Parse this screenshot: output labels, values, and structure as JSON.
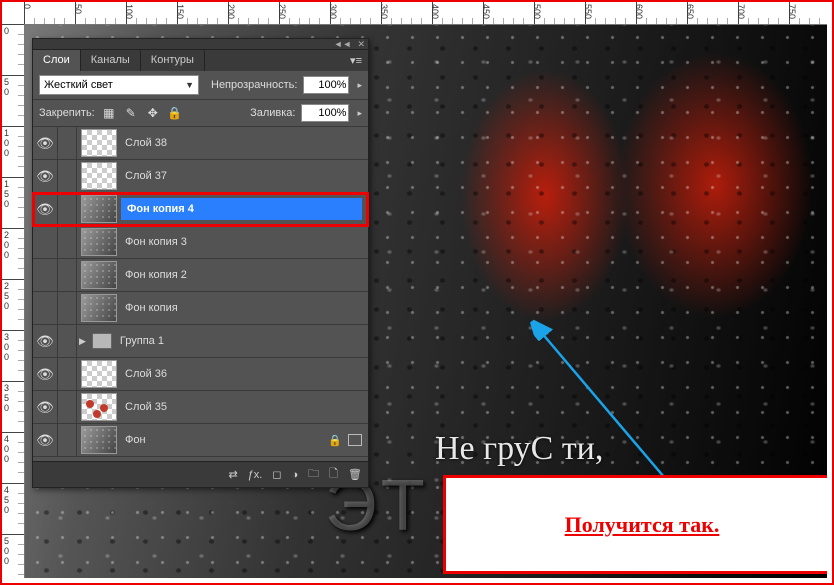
{
  "tabs": {
    "layers": "Слои",
    "channels": "Каналы",
    "paths": "Контуры"
  },
  "blend": {
    "mode": "Жесткий свет",
    "opacity_label": "Непрозрачность:",
    "opacity": "100%",
    "fill_label": "Заливка:",
    "fill": "100%",
    "lock_label": "Закрепить:"
  },
  "layers": [
    {
      "name": "Слой 38",
      "visible": true,
      "thumb": "transparent"
    },
    {
      "name": "Слой 37",
      "visible": true,
      "thumb": "transparent"
    },
    {
      "name": "Фон копия 4",
      "visible": true,
      "thumb": "image",
      "selected": true
    },
    {
      "name": "Фон копия 3",
      "visible": false,
      "thumb": "image"
    },
    {
      "name": "Фон копия 2",
      "visible": false,
      "thumb": "image"
    },
    {
      "name": "Фон копия",
      "visible": false,
      "thumb": "image"
    },
    {
      "name": "Группа 1",
      "visible": true,
      "group": true
    },
    {
      "name": "Слой 36",
      "visible": true,
      "thumb": "transparent"
    },
    {
      "name": "Слой 35",
      "visible": true,
      "thumb": "dots35"
    },
    {
      "name": "Фон",
      "visible": true,
      "thumb": "image",
      "locked": true
    }
  ],
  "canvas": {
    "script_text": "Не груС ти,",
    "big_text": "ЭТ"
  },
  "callout": {
    "text": "Получится так."
  },
  "ruler": {
    "h": [
      "0",
      "50",
      "100",
      "150",
      "200",
      "250",
      "300",
      "350",
      "400",
      "450",
      "500",
      "550",
      "600",
      "650",
      "700",
      "750"
    ],
    "v": [
      "0",
      "50",
      "100",
      "150",
      "200",
      "250",
      "300",
      "350",
      "400",
      "450",
      "500"
    ]
  },
  "colors": {
    "accent": "#2a7fff",
    "highlight": "#e00"
  }
}
